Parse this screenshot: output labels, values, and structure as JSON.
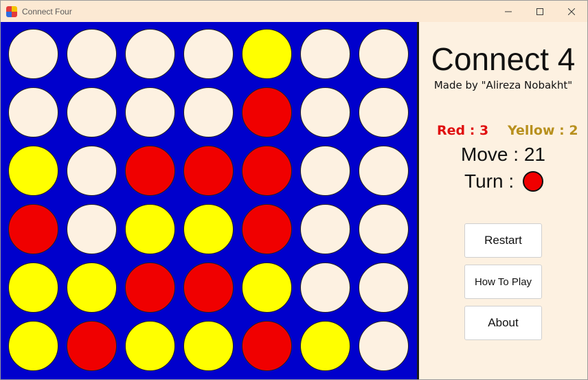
{
  "window": {
    "title": "Connect Four"
  },
  "colors": {
    "board": "#0000cc",
    "empty": "#fdf1e1",
    "red": "#f00000",
    "yellow": "#ffff00"
  },
  "board": [
    [
      "empty",
      "empty",
      "empty",
      "empty",
      "yellow",
      "empty",
      "empty"
    ],
    [
      "empty",
      "empty",
      "empty",
      "empty",
      "red",
      "empty",
      "empty"
    ],
    [
      "yellow",
      "empty",
      "red",
      "red",
      "red",
      "empty",
      "empty"
    ],
    [
      "red",
      "empty",
      "yellow",
      "yellow",
      "red",
      "empty",
      "empty"
    ],
    [
      "yellow",
      "yellow",
      "red",
      "red",
      "yellow",
      "empty",
      "empty"
    ],
    [
      "yellow",
      "red",
      "yellow",
      "yellow",
      "red",
      "yellow",
      "empty"
    ]
  ],
  "panel": {
    "title": "Connect 4",
    "subtitle": "Made by \"Alireza Nobakht\"",
    "score_red": "Red : 3",
    "score_yellow": "Yellow : 2",
    "move": "Move : 21",
    "turn_label": "Turn :",
    "turn_color": "red"
  },
  "buttons": {
    "restart": "Restart",
    "how_to_play": "How To Play",
    "about": "About"
  },
  "icons": {
    "minimize": "minimize-icon",
    "maximize": "maximize-icon",
    "close": "close-icon",
    "app": "app-icon"
  }
}
